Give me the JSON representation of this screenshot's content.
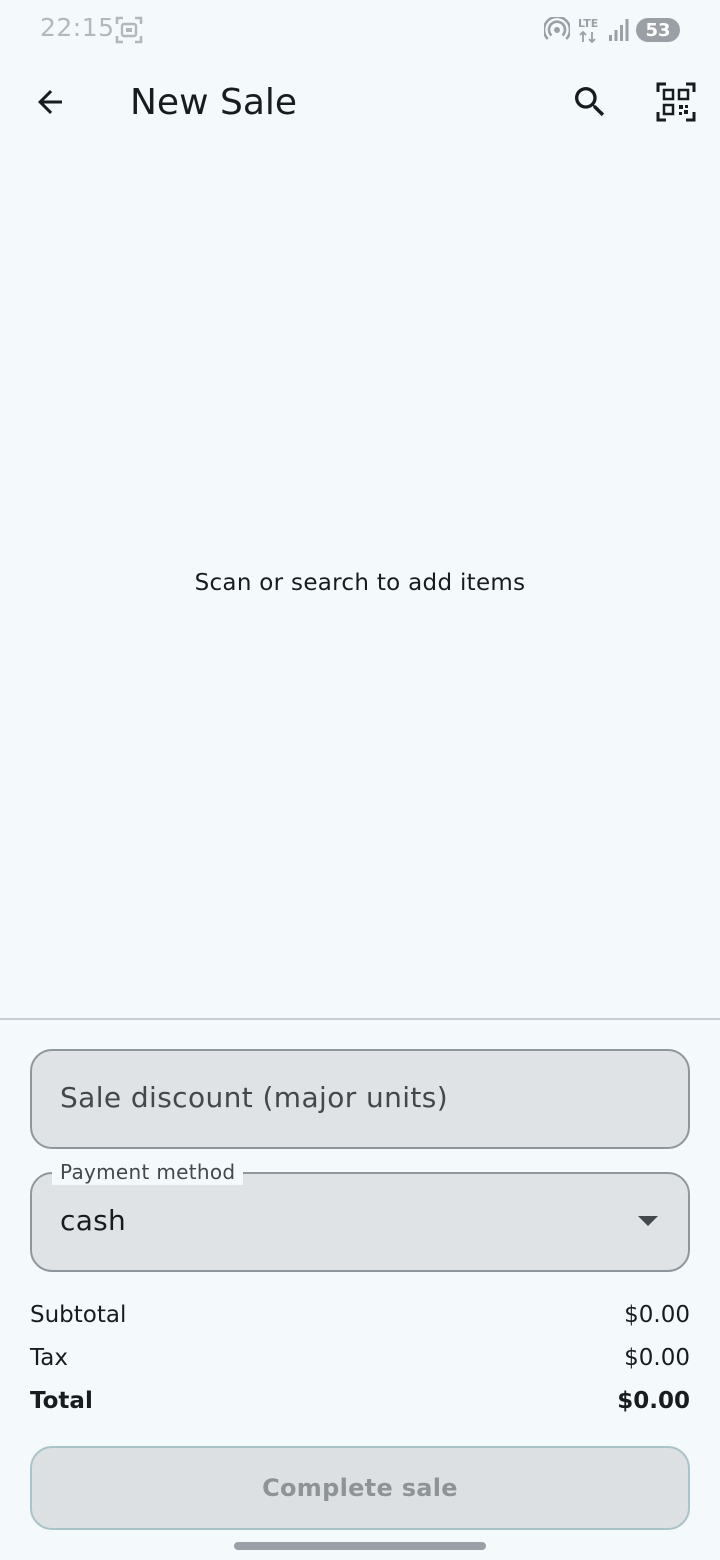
{
  "status_bar": {
    "time": "22:15",
    "battery": "53",
    "network": "LTE",
    "icons": [
      "screenshot-icon",
      "hotspot-icon",
      "lte-icon",
      "signal-icon",
      "battery-icon"
    ]
  },
  "app_bar": {
    "title": "New Sale",
    "icons": [
      "back-arrow-icon",
      "search-icon",
      "qr-code-scan-icon"
    ]
  },
  "empty_state": {
    "message": "Scan or search to add items"
  },
  "form": {
    "discount_placeholder": "Sale discount (major units)",
    "payment_label": "Payment method",
    "payment_value": "cash"
  },
  "summary": {
    "subtotal_label": "Subtotal",
    "subtotal_value": "$0.00",
    "tax_label": "Tax",
    "tax_value": "$0.00",
    "total_label": "Total",
    "total_value": "$0.00"
  },
  "actions": {
    "complete_label": "Complete sale"
  },
  "colors": {
    "background": "#f4f9fc",
    "field_fill": "#dfe3e6",
    "disabled_text": "#8e9396"
  }
}
